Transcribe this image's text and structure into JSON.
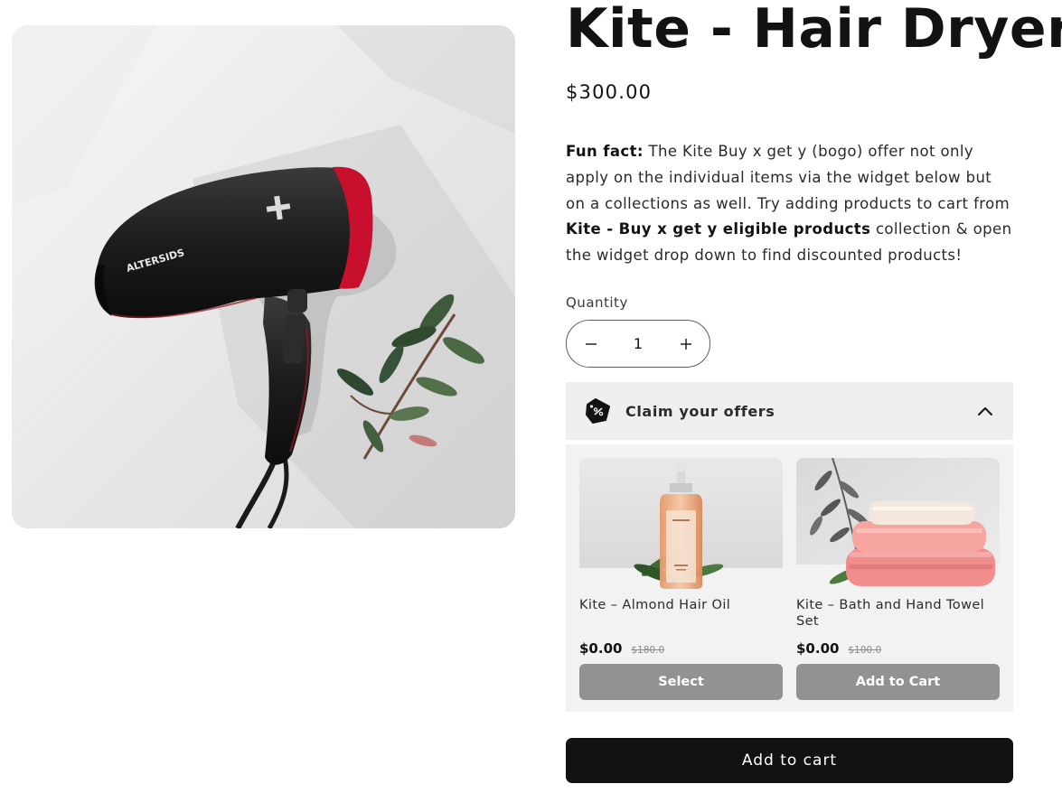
{
  "product": {
    "title": "Kite - Hair Dryer",
    "price": "$300.00",
    "image_alt": "Black hair dryer with red accents lying on a white surface next to a leafy sprig",
    "brand_mark": "ALTERSIDS",
    "description": {
      "fun_fact_label": "Fun fact:",
      "text_1": " The Kite Buy x get y (bogo) offer not only apply on the individual items via the widget below but on a collections as well. Try adding products to cart from ",
      "collection_name": "Kite - Buy x get y eligible products",
      "text_2": " collection & open the widget drop down to find discounted products!"
    }
  },
  "quantity": {
    "label": "Quantity",
    "value": "1",
    "decrease_icon": "minus-icon",
    "increase_icon": "plus-icon"
  },
  "offers": {
    "header_label": "Claim your offers",
    "header_icon": "discount-tag-icon",
    "toggle_icon": "chevron-up-icon",
    "items": [
      {
        "name": "Kite – Almond Hair Oil",
        "price": "$0.00",
        "compare_price": "$180.0",
        "button_label": "Select"
      },
      {
        "name": "Kite – Bath and Hand Towel Set",
        "price": "$0.00",
        "compare_price": "$100.0",
        "button_label": "Add to Cart"
      }
    ]
  },
  "cart": {
    "add_to_cart_label": "Add to cart"
  },
  "colors": {
    "text": "#121212",
    "button_primary": "#121212",
    "button_offer": "#929292",
    "widget_bg": "#efefef",
    "dryer_accent": "#c8102e"
  }
}
